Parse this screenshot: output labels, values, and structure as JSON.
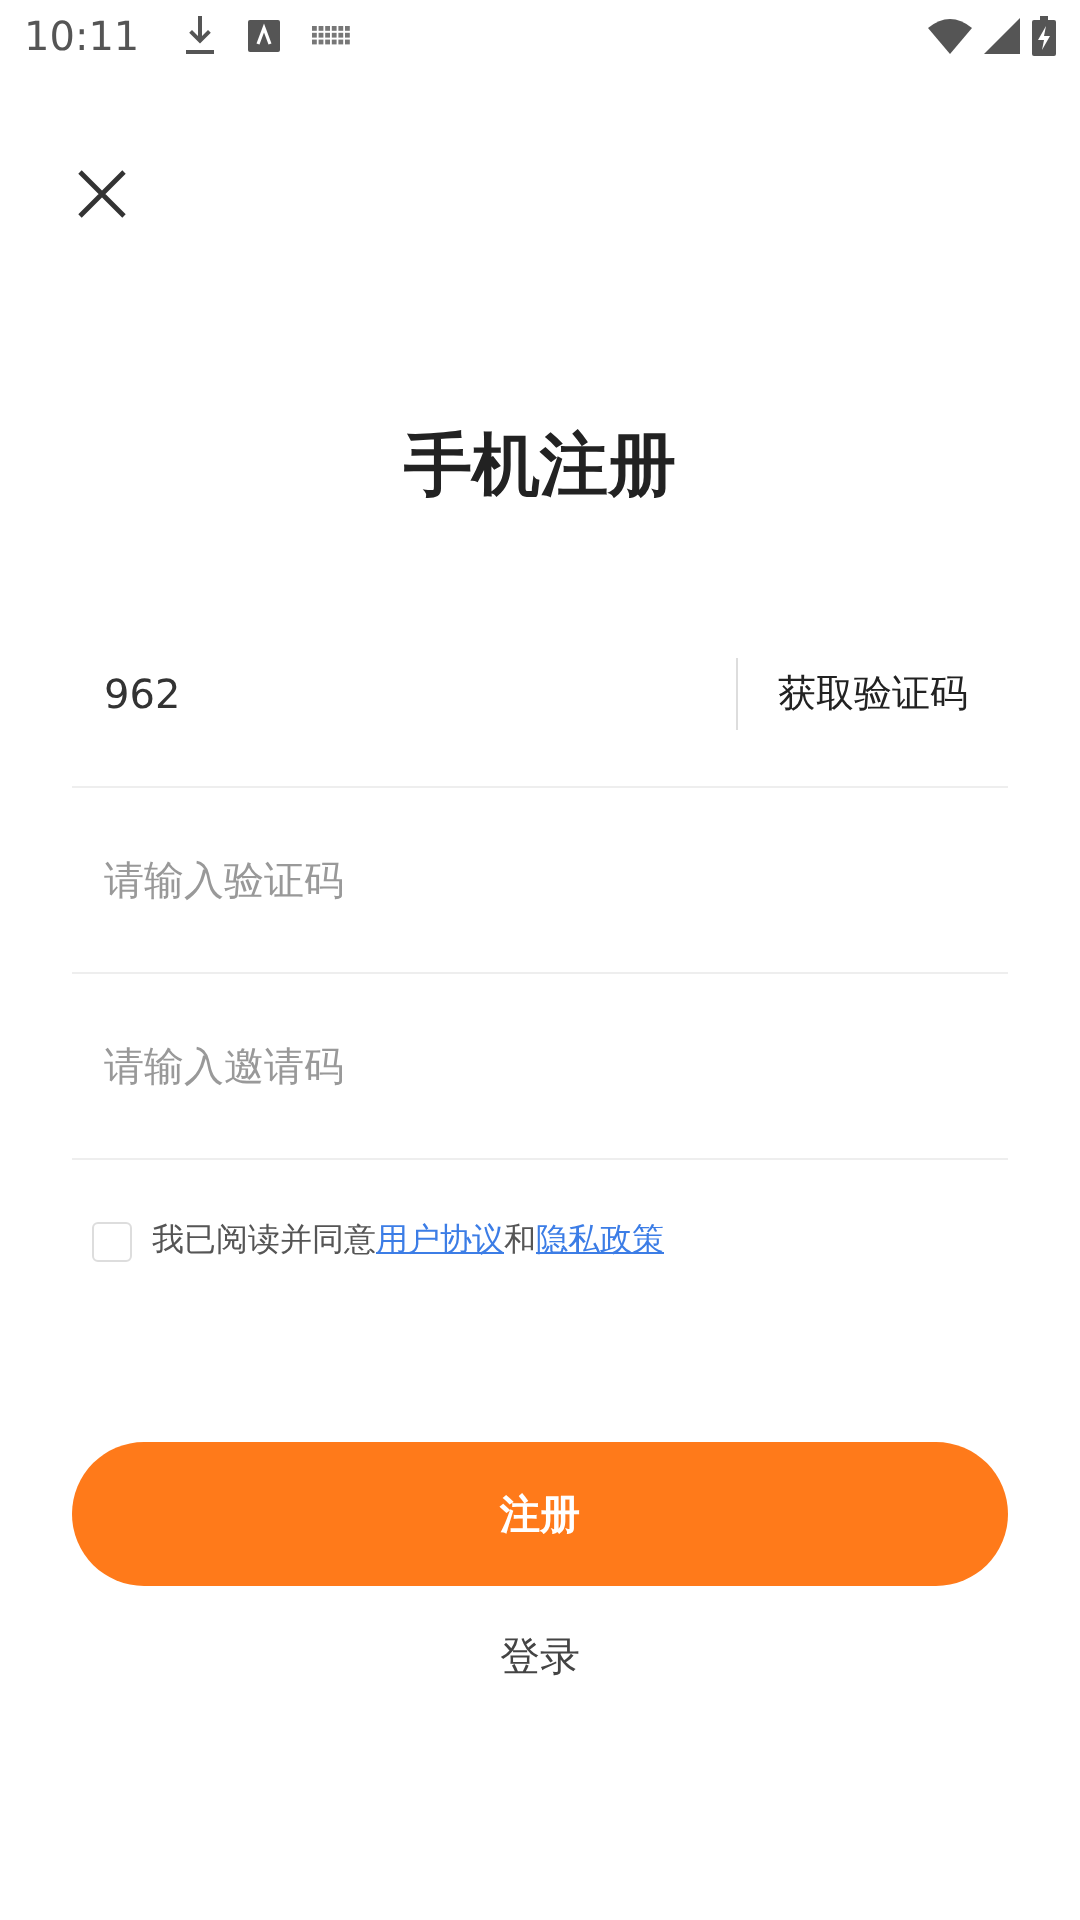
{
  "status_bar": {
    "time": "10:11"
  },
  "title": "手机注册",
  "phone": {
    "value": "962",
    "action": "获取验证码"
  },
  "fields": [
    {
      "placeholder": "请输入验证码"
    },
    {
      "placeholder": "请输入邀请码"
    }
  ],
  "agreement": {
    "checked": false,
    "prefix": "我已阅读并同意",
    "links": [
      "用户协议",
      "隐私政策"
    ],
    "joiner": "和"
  },
  "primary_button": "注册",
  "secondary_link": "登录"
}
